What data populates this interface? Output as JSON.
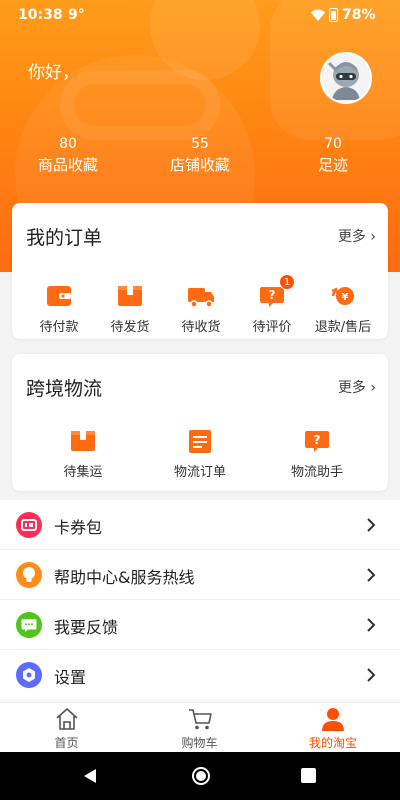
{
  "status_bar": {
    "time": "10:38",
    "temperature": "9°",
    "battery": "78%"
  },
  "profile": {
    "greeting": "你好，"
  },
  "stats": [
    {
      "value": "80",
      "label": "商品收藏"
    },
    {
      "value": "55",
      "label": "店铺收藏"
    },
    {
      "value": "70",
      "label": "足迹"
    }
  ],
  "orders": {
    "title": "我的订单",
    "more": "更多",
    "items": [
      {
        "label": "待付款",
        "icon": "wallet-icon"
      },
      {
        "label": "待发货",
        "icon": "package-icon"
      },
      {
        "label": "待收货",
        "icon": "truck-icon"
      },
      {
        "label": "待评价",
        "icon": "review-icon",
        "badge": "1"
      },
      {
        "label": "退款/售后",
        "icon": "refund-icon"
      }
    ]
  },
  "logistics": {
    "title": "跨境物流",
    "more": "更多",
    "items": [
      {
        "label": "待集运",
        "icon": "box-icon"
      },
      {
        "label": "物流订单",
        "icon": "list-icon"
      },
      {
        "label": "物流助手",
        "icon": "help-icon"
      }
    ]
  },
  "menu": [
    {
      "label": "卡券包",
      "icon": "coupon-icon",
      "color": "#ff2d55"
    },
    {
      "label": "帮助中心&服务热线",
      "icon": "lightbulb-icon",
      "color": "#ff8c1a"
    },
    {
      "label": "我要反馈",
      "icon": "feedback-icon",
      "color": "#52c41a"
    },
    {
      "label": "设置",
      "icon": "settings-icon",
      "color": "#5b6cff"
    }
  ],
  "tabs": [
    {
      "label": "首页",
      "icon": "home-icon"
    },
    {
      "label": "购物车",
      "icon": "cart-icon"
    },
    {
      "label": "我的淘宝",
      "icon": "user-icon",
      "active": true
    }
  ],
  "colors": {
    "accent": "#ff5000",
    "header": "#ff8512"
  }
}
